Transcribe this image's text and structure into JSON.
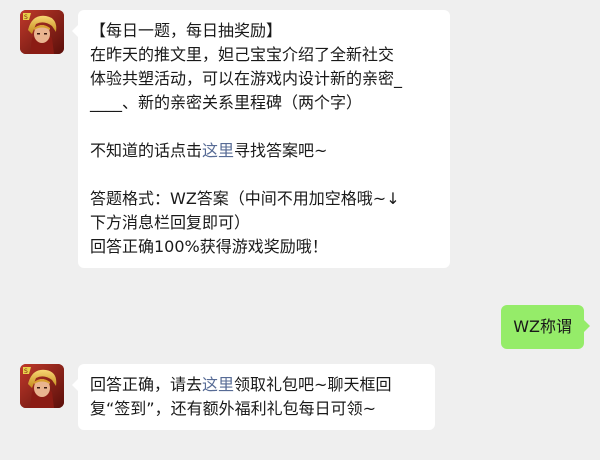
{
  "messages": {
    "question": {
      "header": "【每日一题，每日抽奖励】",
      "line1": "在昨天的推文里，妲己宝宝介绍了全新社交",
      "line2": "体验共塑活动，可以在游戏内设计新的亲密_",
      "line3": "____、新的亲密关系里程碑（两个字）",
      "hint_prefix": "不知道的话点击",
      "hint_link": "这里",
      "hint_suffix": "寻找答案吧~",
      "format_line1": "答题格式：WZ答案（中间不用加空格哦~↓",
      "format_line2": "下方消息栏回复即可）",
      "reward_line": "回答正确100%获得游戏奖励哦！"
    },
    "user_reply": {
      "text": "WZ称谓"
    },
    "answer": {
      "prefix": "回答正确，请去",
      "link": "这里",
      "suffix": "领取礼包吧~聊天框回",
      "line2": "复“签到”，还有额外福利礼包每日可领~"
    }
  },
  "colors": {
    "background": "#efefef",
    "incoming_bubble": "#ffffff",
    "outgoing_bubble": "#95ec69",
    "link": "#576b95"
  }
}
